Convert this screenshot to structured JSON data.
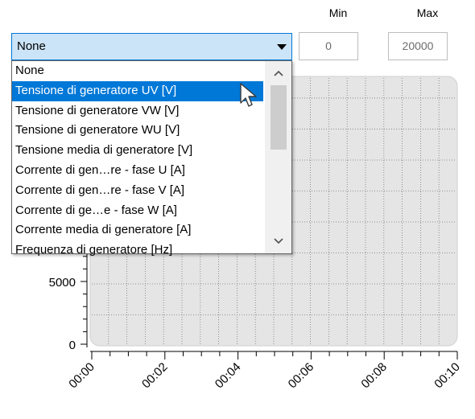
{
  "limits": {
    "min_header": "Min",
    "max_header": "Max",
    "min_value": "0",
    "max_value": "20000"
  },
  "combo": {
    "selected": "None"
  },
  "dropdown": {
    "items": [
      "None",
      "Tensione di generatore UV [V]",
      "Tensione di generatore VW [V]",
      "Tensione di generatore WU [V]",
      "Tensione media di generatore [V]",
      "Corrente di gen…re - fase U [A]",
      "Corrente di gen…re - fase V [A]",
      "Corrente di ge…e - fase W [A]",
      "Corrente media di generatore [A]",
      "Frequenza di generatore [Hz]"
    ],
    "highlighted_index": 1
  },
  "chart": {
    "y_tick_labels": [
      "5000",
      "0"
    ],
    "x_tick_labels": [
      "00:00",
      "00:02",
      "00:04",
      "00:06",
      "00:08",
      "00:10"
    ]
  },
  "colors": {
    "accent": "#0078d7",
    "combo_bg": "#cce4f7",
    "plot_bg": "#e5e5e5"
  }
}
